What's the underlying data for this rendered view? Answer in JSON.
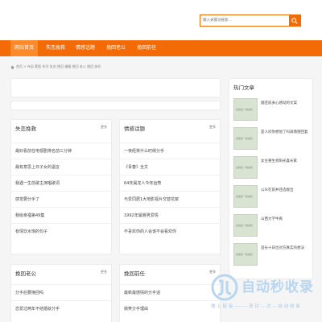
{
  "search": {
    "placeholder": "输入关键词搜索..."
  },
  "nav": [
    {
      "label": "网站首页",
      "active": true
    },
    {
      "label": "失恋挽救",
      "active": false
    },
    {
      "label": "情感话题",
      "active": false
    },
    {
      "label": "挽回老公",
      "active": false
    },
    {
      "label": "挽回前任",
      "active": false
    }
  ],
  "breadcrumb": {
    "text": "首页 > 布局 蒙版 系列 失恋 挽回 婚姻 挽回 老公 挽回 前任"
  },
  "panels": {
    "shilian": {
      "title": "失恋挽救",
      "more": "更多",
      "items": [
        "最好看前任电视剧排名前三分钟",
        "最有意思上日子女的温言",
        "我遇一生前歌主演唱歌词",
        "感觉要分手了",
        "我给幸福第49集",
        "有情饮水饱的句子"
      ]
    },
    "qinggan": {
      "title": "情感话题",
      "more": "更多",
      "items": [
        "一夜经常什么时候分手",
        "《青春》全文",
        "64年属龙人今年运势",
        "与爱同居1大地影视片交替花絮",
        "1992年属猴男爱情",
        "不喜欢你的人会该不会看欢你"
      ]
    },
    "laogong": {
      "title": "挽回老公",
      "more": "更多",
      "items": [
        "分手后要挽回吗",
        "恋爱过两年不结婚就分手"
      ]
    },
    "qianren": {
      "title": "挽回前任",
      "more": "更多",
      "items": [
        "最新最感情的分手话",
        "搞笑分手理由"
      ]
    }
  },
  "hot": {
    "title": "热门文章",
    "thumb_text": "晨报最一晚编找",
    "items": [
      "圆还前关心感动的文案",
      "是人问你想他了吗再情感回复",
      "女主重生到阳光喜长家",
      "公众在前并还选接出",
      "山西大学牛爽",
      "首长十日位对方真实的想法"
    ]
  },
  "watermark": {
    "big": "自动秒收录",
    "small": "做 上 链 接 ——— 来 访 — 次 — 自 动 收 录"
  }
}
